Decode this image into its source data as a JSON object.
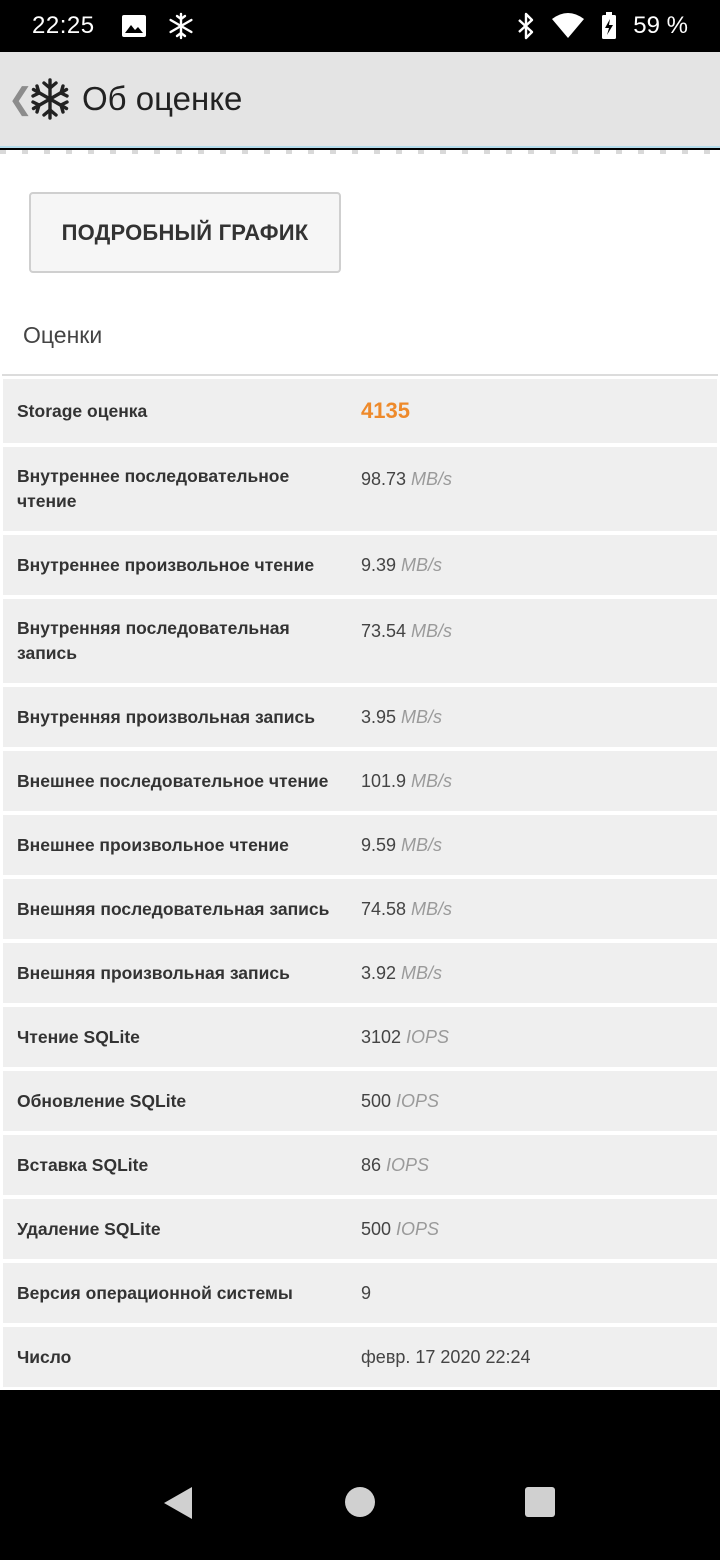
{
  "status_bar": {
    "time": "22:25",
    "battery_text": "59 %",
    "icons_left": [
      "image-icon",
      "snowflake-icon"
    ],
    "icons_right": [
      "bluetooth-icon",
      "wifi-icon",
      "battery-icon"
    ]
  },
  "app_bar": {
    "title": "Об оценке",
    "back_icon": "chevron-left-icon",
    "logo_icon": "snowflake-logo-icon"
  },
  "actions": {
    "graph_button_label": "ПОДРОБНЫЙ ГРАФИК"
  },
  "section": {
    "title": "Оценки"
  },
  "rows": [
    {
      "label": "Storage оценка",
      "value": "4135",
      "unit": ""
    },
    {
      "label": "Внутреннее последовательное чтение",
      "value": "98.73",
      "unit": "MB/s"
    },
    {
      "label": "Внутреннее произвольное чтение",
      "value": "9.39",
      "unit": "MB/s"
    },
    {
      "label": "Внутренняя последовательная запись",
      "value": "73.54",
      "unit": "MB/s"
    },
    {
      "label": "Внутренняя произвольная запись",
      "value": "3.95",
      "unit": "MB/s"
    },
    {
      "label": "Внешнее последовательное чтение",
      "value": "101.9",
      "unit": "MB/s"
    },
    {
      "label": "Внешнее произвольное чтение",
      "value": "9.59",
      "unit": "MB/s"
    },
    {
      "label": "Внешняя последовательная запись",
      "value": "74.58",
      "unit": "MB/s"
    },
    {
      "label": "Внешняя произвольная запись",
      "value": "3.92",
      "unit": "MB/s"
    },
    {
      "label": "Чтение SQLite",
      "value": "3102",
      "unit": "IOPS"
    },
    {
      "label": "Обновление SQLite",
      "value": "500",
      "unit": "IOPS"
    },
    {
      "label": "Вставка SQLite",
      "value": "86",
      "unit": "IOPS"
    },
    {
      "label": "Удаление SQLite",
      "value": "500",
      "unit": "IOPS"
    },
    {
      "label": "Версия операционной системы",
      "value": "9",
      "unit": ""
    },
    {
      "label": "Число",
      "value": "февр. 17 2020 22:24",
      "unit": ""
    }
  ],
  "colors": {
    "score": "#ee8a2b",
    "app_bar_bg": "#e4e4e4",
    "row_bg": "#efefef",
    "unit_text": "#9a9a9a"
  },
  "nav_bar": {
    "back_icon": "triangle-back-icon",
    "home_icon": "circle-home-icon",
    "recents_icon": "square-recents-icon"
  }
}
